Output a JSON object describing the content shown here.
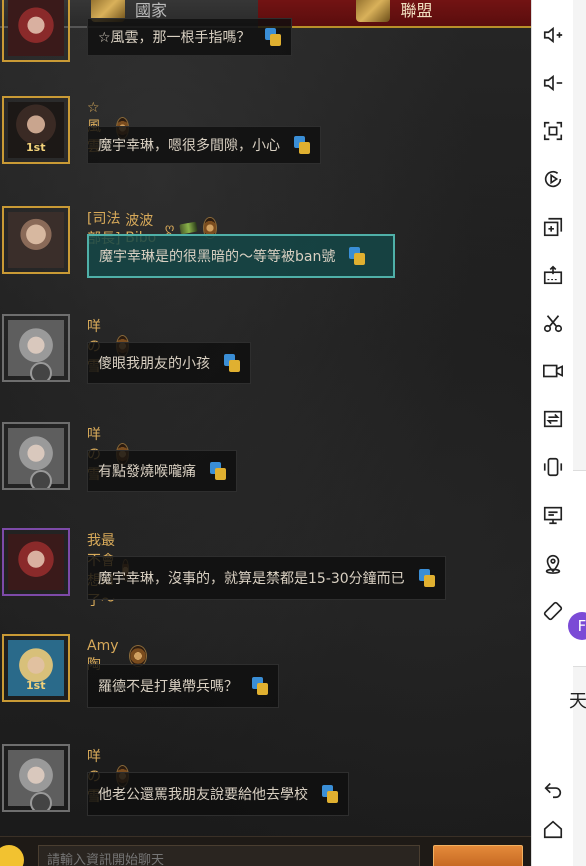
{
  "tabs": {
    "nation": "國家",
    "alliance": "聯盟"
  },
  "messages": [
    {
      "name": "",
      "text": "☆風雲，那一根手指嗎？"
    },
    {
      "name": "☆風雲",
      "text": "魔宇幸琳，嗯很多間隙，小心",
      "level": "1st"
    },
    {
      "title": "[司法部長]",
      "name": "波波Bibo",
      "heart": "ღ",
      "text": "魔宇幸琳是的很黑暗的～等等被ban號"
    },
    {
      "name": "咩の雪",
      "text": "傻眼我朋友的小孩"
    },
    {
      "name": "咩の雪",
      "text": "有點發燒喉嚨痛"
    },
    {
      "name": "我最不會想id了～",
      "text": "魔宇幸琳，沒事的，就算是禁都是15-30分鐘而已"
    },
    {
      "name": "Amy陶",
      "text": "羅德不是打巢帶兵嗎？",
      "level": "1st"
    },
    {
      "name": "咩の雪",
      "text": "他老公還罵我朋友說要給他去學校"
    }
  ],
  "input": {
    "placeholder": "請輸入資訊開始聊天"
  },
  "toolbar": {
    "icons": [
      "volume-up-icon",
      "volume-down-icon",
      "fullscreen-icon",
      "record-icon",
      "multi-instance-icon",
      "apk-install-icon",
      "screenshot-icon",
      "video-icon",
      "sync-icon",
      "shake-icon",
      "screen-icon",
      "location-icon",
      "rotate-icon",
      "back-icon",
      "home-icon"
    ]
  },
  "edge": {
    "avatar_letter": "F",
    "char": "天"
  }
}
